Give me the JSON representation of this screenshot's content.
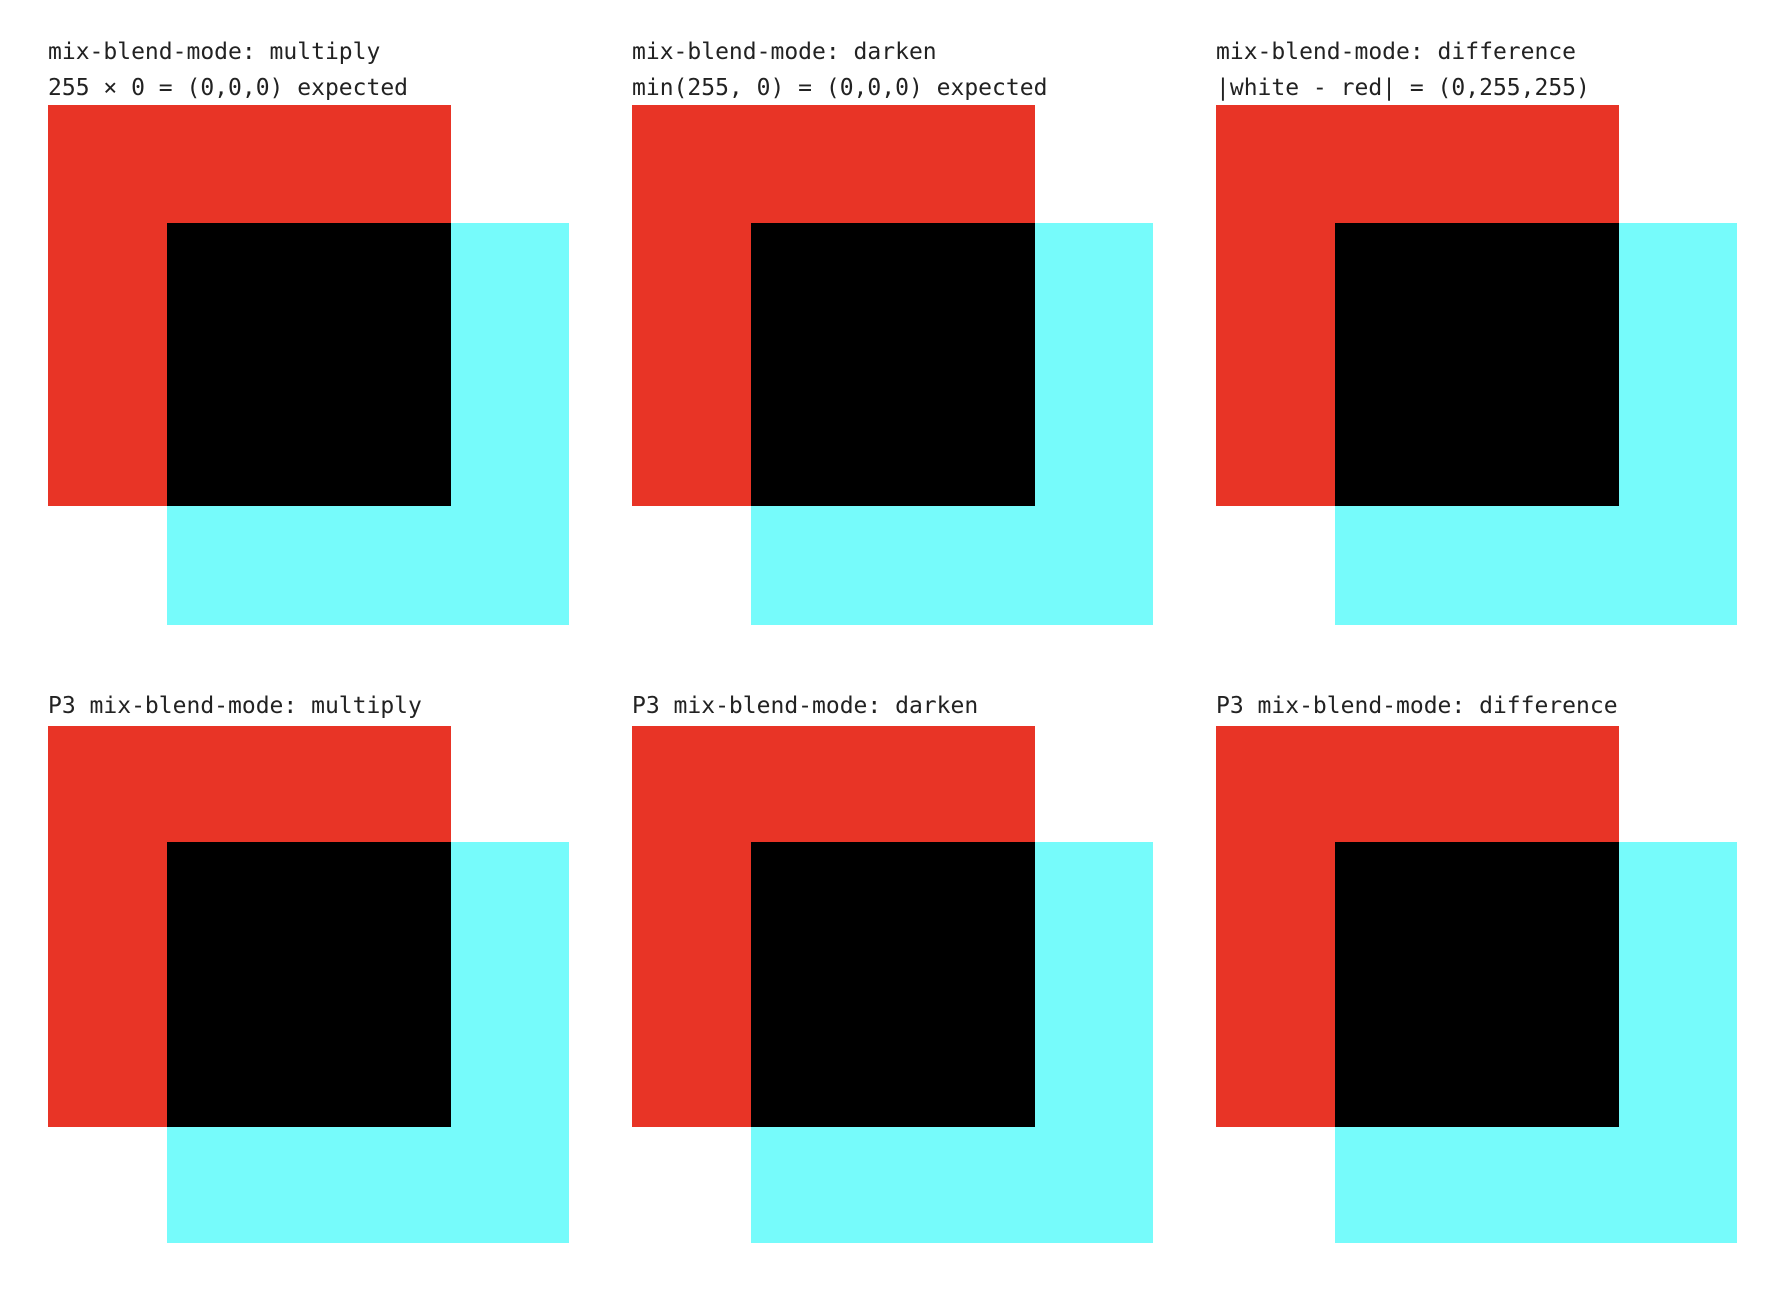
{
  "colors": {
    "background": "#ffffff",
    "red": "#e83426",
    "cyan": "#76fbfb",
    "overlap": "#000000",
    "text": "#222222"
  },
  "panels": [
    {
      "caption_line_1": "mix-blend-mode: multiply",
      "caption_line_2": "255 × 0 = (0,0,0) expected"
    },
    {
      "caption_line_1": "mix-blend-mode: darken",
      "caption_line_2": "min(255, 0) = (0,0,0) expected"
    },
    {
      "caption_line_1": "mix-blend-mode: difference",
      "caption_line_2": "|white - red| = (0,255,255)"
    },
    {
      "caption_line_1": "P3 mix-blend-mode: multiply"
    },
    {
      "caption_line_1": "P3 mix-blend-mode: darken"
    },
    {
      "caption_line_1": "P3 mix-blend-mode: difference"
    }
  ]
}
